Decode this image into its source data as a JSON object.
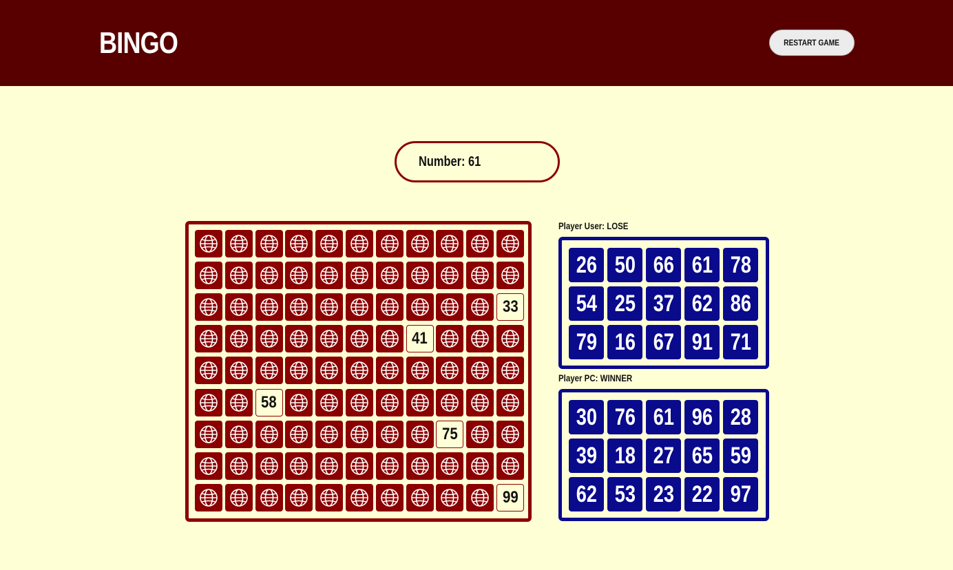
{
  "header": {
    "title": "BINGO",
    "restart_label": "RESTART GAME"
  },
  "current": {
    "label": "Number: 61"
  },
  "board": {
    "rows": 9,
    "cols": 11,
    "cell_icon": "globe-icon",
    "revealed": [
      {
        "row": 2,
        "col": 10,
        "value": "33"
      },
      {
        "row": 3,
        "col": 7,
        "value": "41"
      },
      {
        "row": 5,
        "col": 2,
        "value": "58"
      },
      {
        "row": 6,
        "col": 8,
        "value": "75"
      },
      {
        "row": 8,
        "col": 10,
        "value": "99"
      }
    ]
  },
  "players": [
    {
      "label": "Player User: LOSE",
      "numbers": [
        [
          "26",
          "50",
          "66",
          "61",
          "78"
        ],
        [
          "54",
          "25",
          "37",
          "62",
          "86"
        ],
        [
          "79",
          "16",
          "67",
          "91",
          "71"
        ]
      ]
    },
    {
      "label": "Player PC: WINNER",
      "numbers": [
        [
          "30",
          "76",
          "61",
          "96",
          "28"
        ],
        [
          "39",
          "18",
          "27",
          "65",
          "59"
        ],
        [
          "62",
          "53",
          "23",
          "22",
          "97"
        ]
      ]
    }
  ],
  "colors": {
    "header_bg": "#580000",
    "page_bg": "#ffffd6",
    "board_accent": "#8b0000",
    "card_accent": "#0a0a8c"
  }
}
